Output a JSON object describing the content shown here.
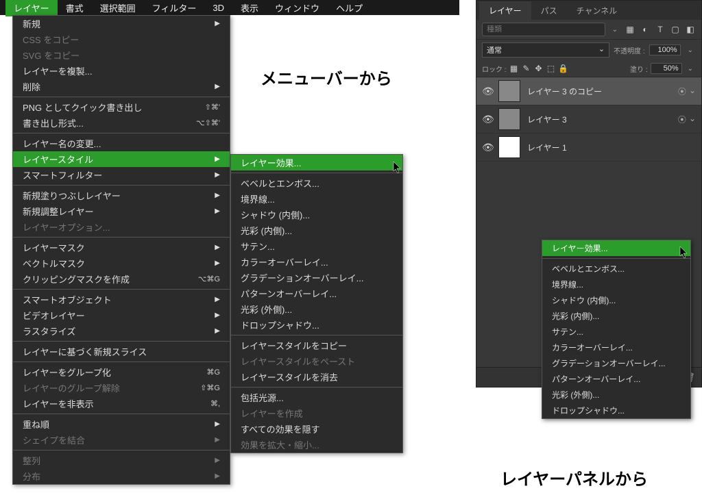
{
  "menubar": {
    "items": [
      "レイヤー",
      "書式",
      "選択範囲",
      "フィルター",
      "3D",
      "表示",
      "ウィンドウ",
      "ヘルプ"
    ],
    "active_index": 0
  },
  "dropdown": {
    "groups": [
      [
        {
          "label": "新規",
          "arrow": true
        },
        {
          "label": "CSS をコピー",
          "disabled": true
        },
        {
          "label": "SVG をコピー",
          "disabled": true
        },
        {
          "label": "レイヤーを複製..."
        },
        {
          "label": "削除",
          "arrow": true
        }
      ],
      [
        {
          "label": "PNG としてクイック書き出し",
          "shortcut": "⇧⌘'"
        },
        {
          "label": "書き出し形式...",
          "shortcut": "⌥⇧⌘'"
        }
      ],
      [
        {
          "label": "レイヤー名の変更..."
        },
        {
          "label": "レイヤースタイル",
          "arrow": true,
          "highlight": true
        },
        {
          "label": "スマートフィルター",
          "arrow": true
        }
      ],
      [
        {
          "label": "新規塗りつぶしレイヤー",
          "arrow": true
        },
        {
          "label": "新規調整レイヤー",
          "arrow": true
        },
        {
          "label": "レイヤーオプション...",
          "disabled": true
        }
      ],
      [
        {
          "label": "レイヤーマスク",
          "arrow": true
        },
        {
          "label": "ベクトルマスク",
          "arrow": true
        },
        {
          "label": "クリッピングマスクを作成",
          "shortcut": "⌥⌘G"
        }
      ],
      [
        {
          "label": "スマートオブジェクト",
          "arrow": true
        },
        {
          "label": "ビデオレイヤー",
          "arrow": true
        },
        {
          "label": "ラスタライズ",
          "arrow": true
        }
      ],
      [
        {
          "label": "レイヤーに基づく新規スライス"
        }
      ],
      [
        {
          "label": "レイヤーをグループ化",
          "shortcut": "⌘G"
        },
        {
          "label": "レイヤーのグループ解除",
          "shortcut": "⇧⌘G",
          "disabled": true
        },
        {
          "label": "レイヤーを非表示",
          "shortcut": "⌘,"
        }
      ],
      [
        {
          "label": "重ね順",
          "arrow": true
        },
        {
          "label": "シェイプを結合",
          "arrow": true,
          "disabled": true
        }
      ],
      [
        {
          "label": "整列",
          "arrow": true,
          "disabled": true
        },
        {
          "label": "分布",
          "arrow": true,
          "disabled": true
        }
      ]
    ]
  },
  "submenu": {
    "groups": [
      [
        {
          "label": "レイヤー効果...",
          "highlight": true
        }
      ],
      [
        {
          "label": "ベベルとエンボス..."
        },
        {
          "label": "境界線..."
        },
        {
          "label": "シャドウ (内側)..."
        },
        {
          "label": "光彩 (内側)..."
        },
        {
          "label": "サテン..."
        },
        {
          "label": "カラーオーバーレイ..."
        },
        {
          "label": "グラデーションオーバーレイ..."
        },
        {
          "label": "パターンオーバーレイ..."
        },
        {
          "label": "光彩 (外側)..."
        },
        {
          "label": "ドロップシャドウ..."
        }
      ],
      [
        {
          "label": "レイヤースタイルをコピー"
        },
        {
          "label": "レイヤースタイルをペースト",
          "disabled": true
        },
        {
          "label": "レイヤースタイルを消去"
        }
      ],
      [
        {
          "label": "包括光源..."
        },
        {
          "label": "レイヤーを作成",
          "disabled": true
        },
        {
          "label": "すべての効果を隠す"
        },
        {
          "label": "効果を拡大・縮小...",
          "disabled": true
        }
      ]
    ]
  },
  "captions": {
    "left": "メニューバーから",
    "right": "レイヤーパネルから"
  },
  "panel": {
    "tabs": [
      "レイヤー",
      "パス",
      "チャンネル"
    ],
    "active_tab": 0,
    "search_placeholder": "種類",
    "filter_icons": [
      "image-icon",
      "adjust-icon",
      "type-icon",
      "shape-icon",
      "smart-icon"
    ],
    "blend_mode": "通常",
    "opacity_label": "不透明度 :",
    "opacity_value": "100%",
    "lock_label": "ロック :",
    "lock_icons": [
      "pixel-lock",
      "brush-lock",
      "move-lock",
      "artboard-lock",
      "all-lock"
    ],
    "fill_label": "塗り :",
    "fill_value": "50%",
    "layers": [
      {
        "name": "レイヤー 3 のコピー",
        "visible": true,
        "fx": true,
        "selected": true
      },
      {
        "name": "レイヤー 3",
        "visible": true,
        "fx": true
      },
      {
        "name": "レイヤー 1",
        "visible": true,
        "white": true
      }
    ],
    "footer_icons": [
      "link",
      "fx",
      "mask",
      "adjustment",
      "group",
      "new",
      "trash"
    ]
  },
  "context_menu": {
    "groups": [
      [
        {
          "label": "レイヤー効果...",
          "highlight": true
        }
      ],
      [
        {
          "label": "ベベルとエンボス..."
        },
        {
          "label": "境界線..."
        },
        {
          "label": "シャドウ (内側)..."
        },
        {
          "label": "光彩 (内側)..."
        },
        {
          "label": "サテン..."
        },
        {
          "label": "カラーオーバーレイ..."
        },
        {
          "label": "グラデーションオーバーレイ..."
        },
        {
          "label": "パターンオーバーレイ..."
        },
        {
          "label": "光彩 (外側)..."
        },
        {
          "label": "ドロップシャドウ..."
        }
      ]
    ]
  }
}
